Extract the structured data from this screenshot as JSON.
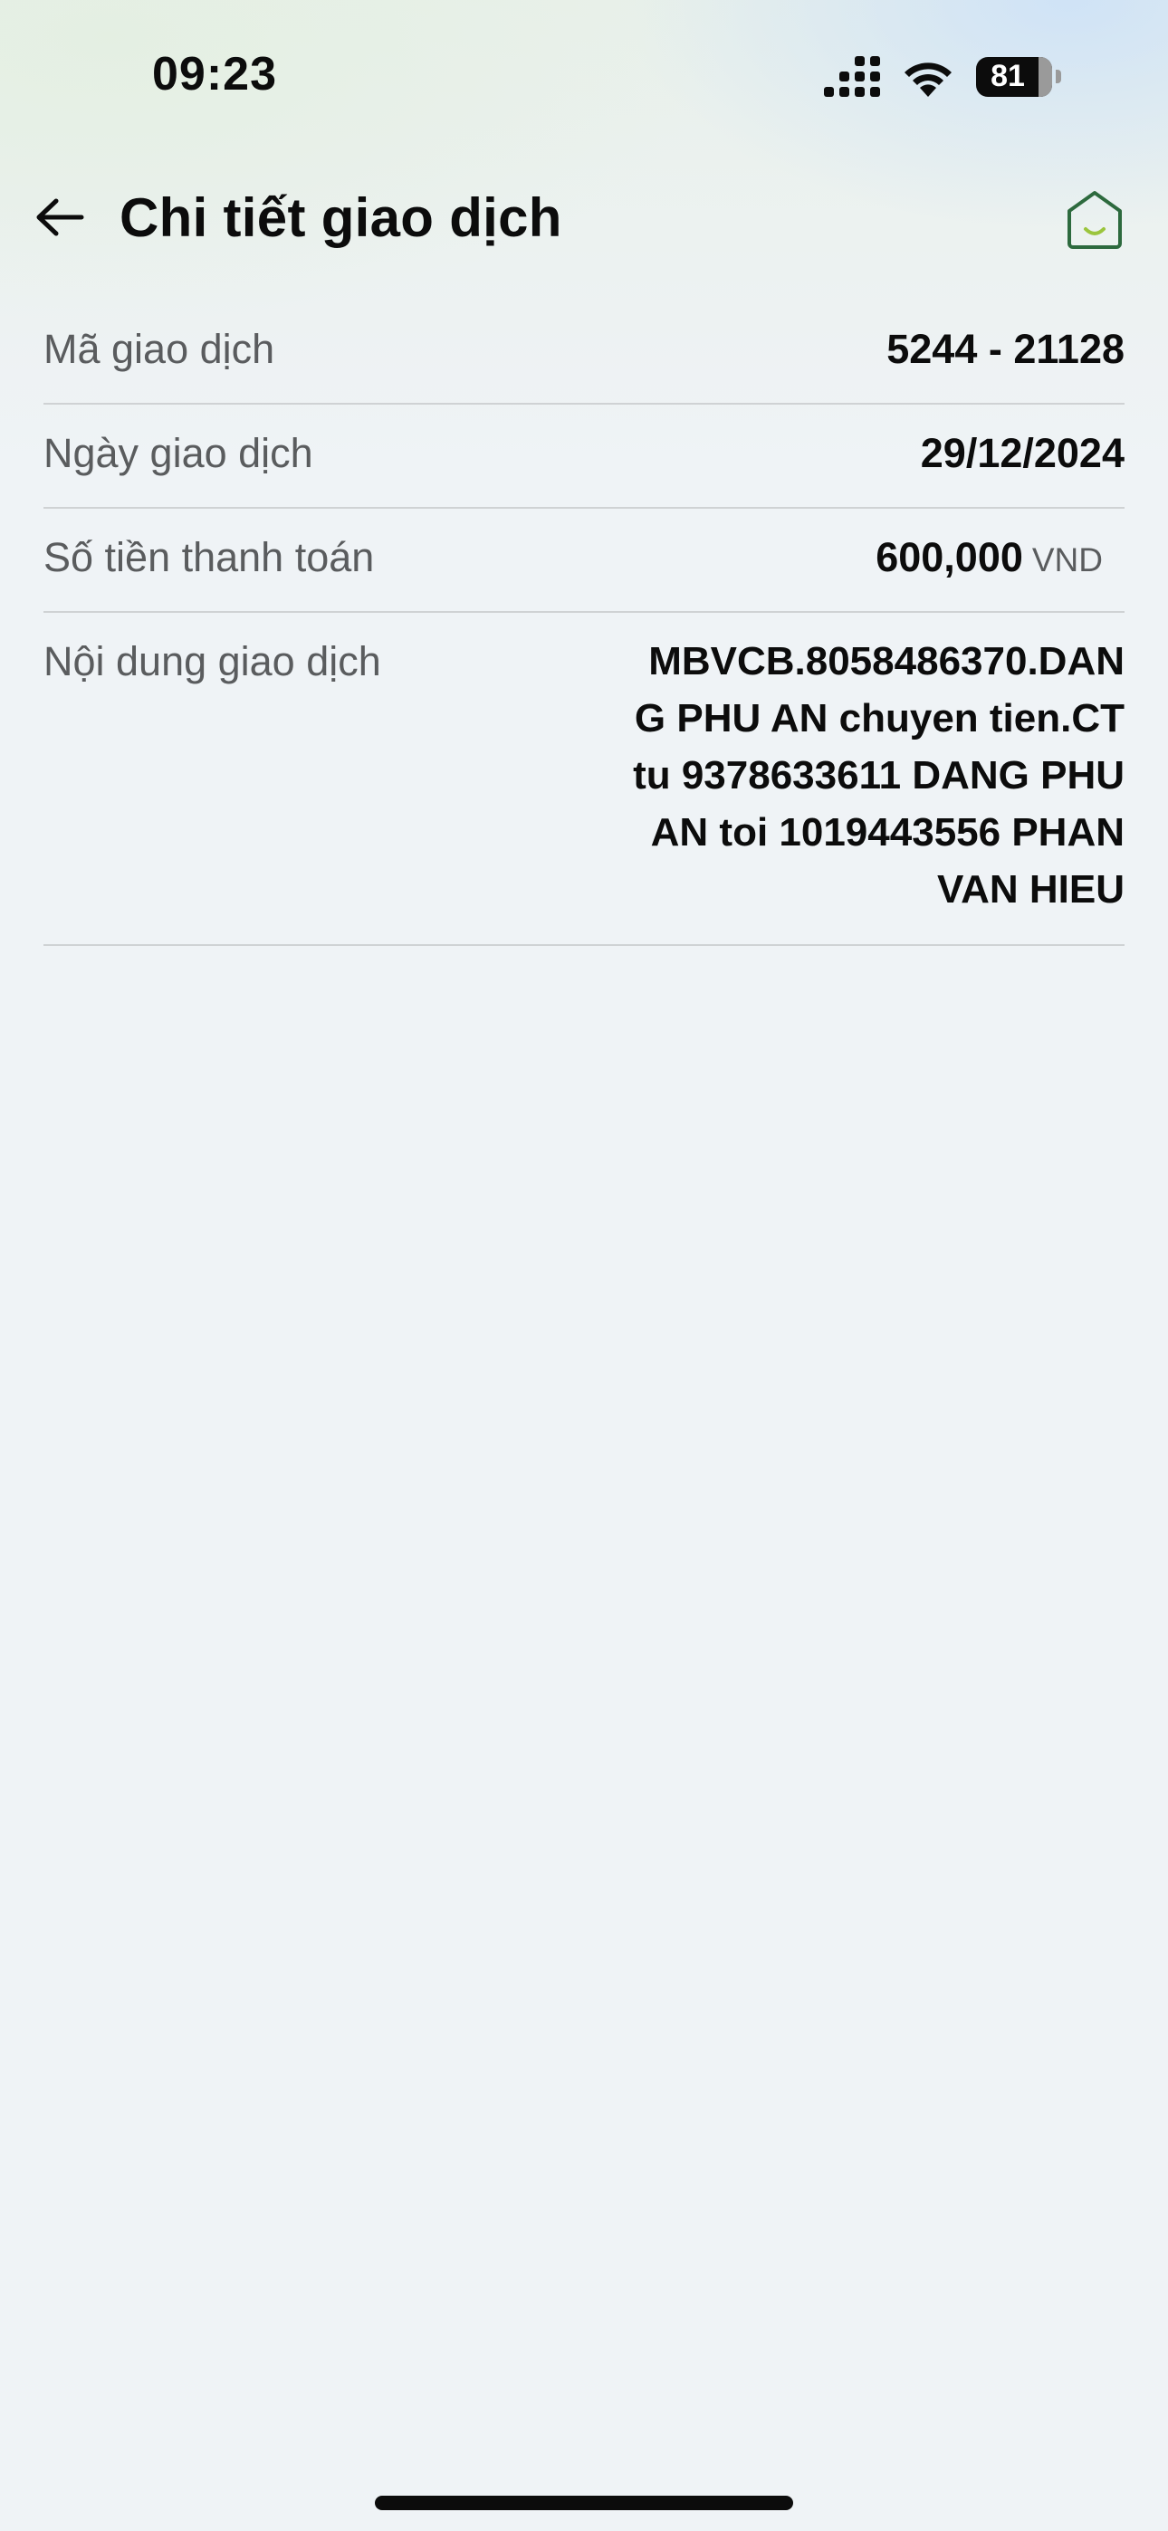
{
  "status_bar": {
    "time": "09:23",
    "battery": "81"
  },
  "header": {
    "title": "Chi tiết giao dịch",
    "back_icon": "arrow-left-icon",
    "home_icon": "home-icon"
  },
  "details": [
    {
      "label": "Mã giao dịch",
      "value": "5244 - 21128"
    },
    {
      "label": "Ngày giao dịch",
      "value": "29/12/2024"
    },
    {
      "label": "Số tiền thanh toán",
      "value": "600,000",
      "currency": "VND"
    },
    {
      "label": "Nội dung giao dịch",
      "lines": [
        "MBVCB.8058486370.DAN",
        "G PHU AN chuyen tien.CT",
        "tu 9378633611 DANG PHU",
        "AN toi 1019443556 PHAN",
        "VAN HIEU"
      ]
    }
  ],
  "colors": {
    "background": "#eff3f6",
    "text": "#0c0c0c",
    "label": "#5a5c5e",
    "divider": "#cfd2d4",
    "brand_green": "#2d6a3e",
    "brand_lime": "#9bc53d"
  }
}
